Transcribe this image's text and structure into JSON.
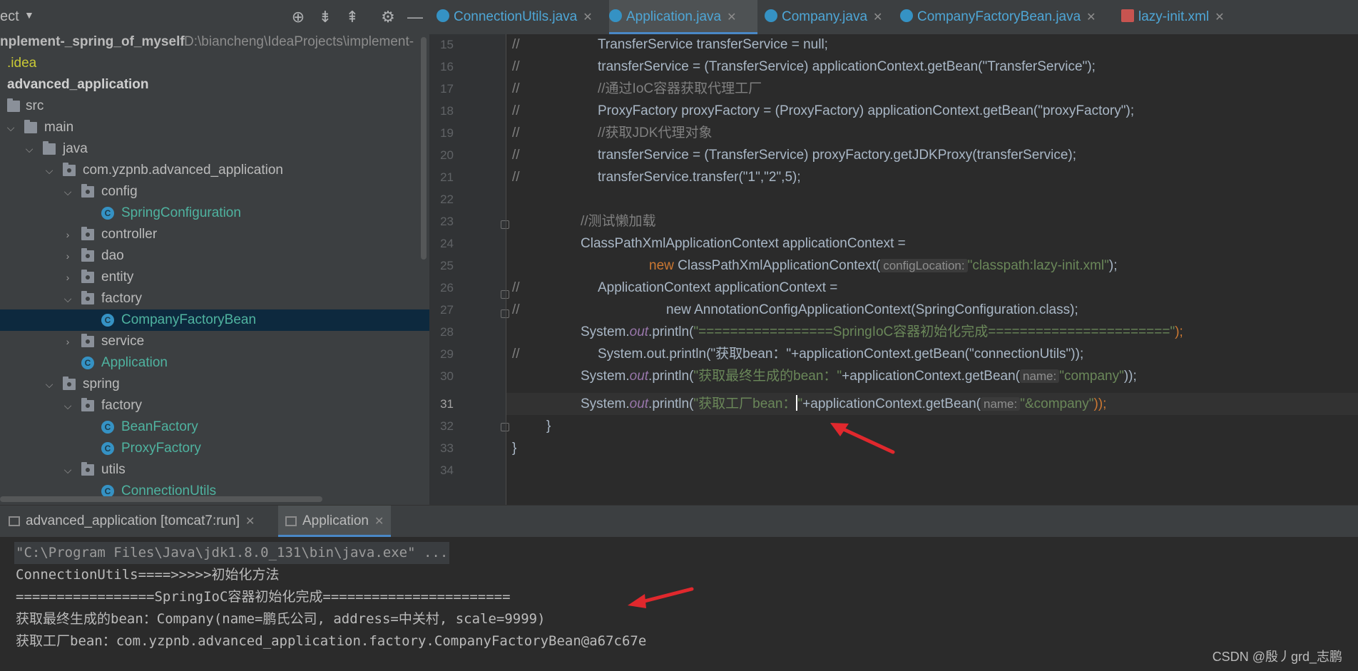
{
  "project_panel": {
    "title": "ect",
    "toolbar_icons": [
      "locate-icon",
      "expand-all-icon",
      "collapse-all-icon",
      "gear-icon",
      "minimize-icon"
    ],
    "root_label": "nplement-_spring_of_myself",
    "root_path": "D:\\biancheng\\IdeaProjects\\implement-",
    "tree": [
      {
        "label": ".idea",
        "kind": "folder"
      },
      {
        "label": "advanced_application",
        "kind": "module"
      },
      {
        "label": "src",
        "kind": "folder"
      },
      {
        "label": "main",
        "kind": "folder"
      },
      {
        "label": "java",
        "kind": "folder"
      },
      {
        "label": "com.yzpnb.advanced_application",
        "kind": "package"
      },
      {
        "label": "config",
        "kind": "package"
      },
      {
        "label": "SpringConfiguration",
        "kind": "class"
      },
      {
        "label": "controller",
        "kind": "package"
      },
      {
        "label": "dao",
        "kind": "package"
      },
      {
        "label": "entity",
        "kind": "package"
      },
      {
        "label": "factory",
        "kind": "package"
      },
      {
        "label": "CompanyFactoryBean",
        "kind": "class",
        "selected": true
      },
      {
        "label": "service",
        "kind": "package"
      },
      {
        "label": "Application",
        "kind": "class"
      },
      {
        "label": "spring",
        "kind": "package"
      },
      {
        "label": "factory",
        "kind": "package"
      },
      {
        "label": "BeanFactory",
        "kind": "class"
      },
      {
        "label": "ProxyFactory",
        "kind": "class"
      },
      {
        "label": "utils",
        "kind": "package"
      },
      {
        "label": "ConnectionUtils",
        "kind": "class"
      }
    ]
  },
  "editor_tabs": [
    {
      "label": "ConnectionUtils.java"
    },
    {
      "label": "Application.java",
      "active": true
    },
    {
      "label": "Company.java"
    },
    {
      "label": "CompanyFactoryBean.java"
    },
    {
      "label": "lazy-init.xml"
    }
  ],
  "code": {
    "line_numbers": [
      "15",
      "16",
      "17",
      "18",
      "19",
      "20",
      "21",
      "22",
      "23",
      "24",
      "25",
      "26",
      "27",
      "28",
      "29",
      "30",
      "31",
      "32",
      "33",
      "34"
    ],
    "current_line": "31",
    "lines": {
      "l15a": "//",
      "l15b": "TransferService transferService = null;",
      "l16a": "//",
      "l16b": "transferService = (TransferService) applicationContext.getBean(\"TransferService\");",
      "l17a": "//",
      "l17b": "//通过IoC容器获取代理工厂",
      "l18a": "//",
      "l18b": "ProxyFactory proxyFactory = (ProxyFactory) applicationContext.getBean(\"proxyFactory\");",
      "l19a": "//",
      "l19b": "//获取JDK代理对象",
      "l20a": "//",
      "l20b": "transferService = (TransferService) proxyFactory.getJDKProxy(transferService);",
      "l21a": "//",
      "l21b": "transferService.transfer(\"1\",\"2\",5);",
      "l23": "//测试懒加载",
      "l24": "ClassPathXmlApplicationContext applicationContext =",
      "l25_kw": "new",
      "l25_code": " ClassPathXmlApplicationContext(",
      "l25_hint": "configLocation:",
      "l25_str": "\"classpath:lazy-init.xml\"",
      "l25_end": ");",
      "l26a": "//",
      "l26b": "ApplicationContext applicationContext =",
      "l27a": "//",
      "l27b": "new AnnotationConfigApplicationContext(SpringConfiguration.class);",
      "l28_a": "System.",
      "l28_out": "out",
      "l28_b": ".println(",
      "l28_str": "\"=================SpringIoC容器初始化完成=======================\"",
      "l28_end": ");",
      "l29a": "//",
      "l29b": "System.out.println(\"获取bean：\"+applicationContext.getBean(\"connectionUtils\"));",
      "l30_a": "System.",
      "l30_out": "out",
      "l30_b": ".println(",
      "l30_str": "\"获取最终生成的bean：\"",
      "l30_c": "+applicationContext.getBean(",
      "l30_hint": "name:",
      "l30_str2": "\"company\"",
      "l30_end": "));",
      "l31_a": "System.",
      "l31_out": "out",
      "l31_b": ".println(",
      "l31_str": "\"获取工厂bean：",
      "l31_str_end": "\"",
      "l31_c": "+applicationContext.getBean(",
      "l31_hint": "name:",
      "l31_str2": "\"&company\"",
      "l31_end": "));",
      "l32": "}",
      "l33": "}"
    }
  },
  "run_panel": {
    "tabs": [
      {
        "label": "advanced_application [tomcat7:run]"
      },
      {
        "label": "Application",
        "active": true
      }
    ],
    "output": [
      "\"C:\\Program Files\\Java\\jdk1.8.0_131\\bin\\java.exe\" ...",
      "ConnectionUtils====>>>>>初始化方法",
      "=================SpringIoC容器初始化完成=======================",
      "获取最终生成的bean：Company(name=鹏氏公司, address=中关村, scale=9999)",
      "获取工厂bean：com.yzpnb.advanced_application.factory.CompanyFactoryBean@a67c67e"
    ]
  },
  "watermark": "CSDN @殷丿grd_志鹏",
  "colors": {
    "accent_blue": "#4a88c7",
    "selection": "#0d293e",
    "arrow_red": "#e0282d"
  }
}
